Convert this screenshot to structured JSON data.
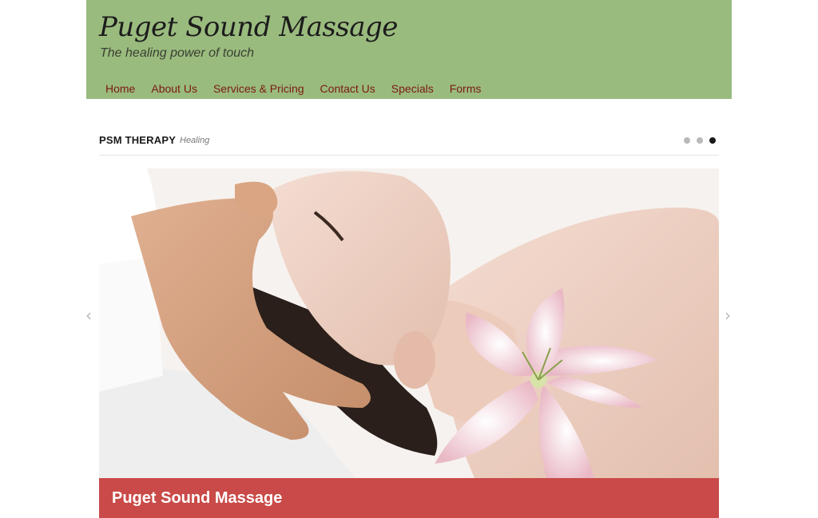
{
  "header": {
    "title": "Puget Sound Massage",
    "tagline": "The healing power of touch"
  },
  "nav": [
    {
      "label": "Home"
    },
    {
      "label": "About Us"
    },
    {
      "label": "Services & Pricing"
    },
    {
      "label": "Contact Us"
    },
    {
      "label": "Specials"
    },
    {
      "label": "Forms"
    }
  ],
  "slider": {
    "label": "PSM THERAPY",
    "sublabel": "Healing",
    "active_slide": 3,
    "slide_count": 3,
    "caption": "Puget Sound Massage",
    "prev_icon": "chevron-left-icon",
    "next_icon": "chevron-right-icon"
  },
  "colors": {
    "header_bg": "#9abb7e",
    "nav_text": "#7a1a12",
    "caption_bg": "#c94a48"
  }
}
